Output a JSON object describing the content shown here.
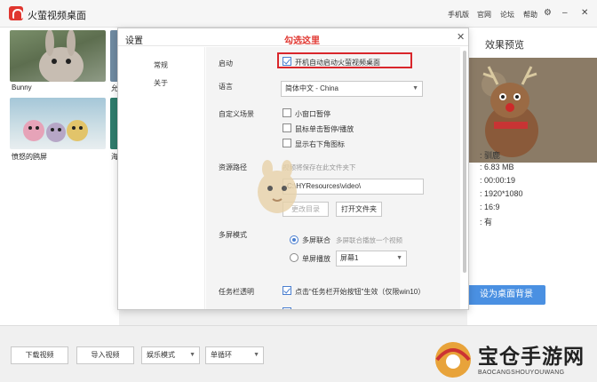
{
  "app": {
    "title": "火萤视频桌面"
  },
  "topnav": {
    "mobile": "手机版",
    "website": "官网",
    "forum": "论坛",
    "help": "帮助"
  },
  "wallpapers": [
    {
      "label": "Bunny"
    },
    {
      "label": "允"
    },
    {
      "label": "愤怒的鸥屏"
    },
    {
      "label": "海"
    }
  ],
  "preview": {
    "title": "效果预览",
    "name": "驯鹿",
    "size": "6.83 MB",
    "duration": "00:00:19",
    "resolution": "1920*1080",
    "ratio": "16:9",
    "sound": "有",
    "set_bg_label": "设为桌面背景"
  },
  "bottom": {
    "download_label": "下载视频",
    "import_label": "导入视频",
    "mode_value": "娱乐模式",
    "loop_value": "单循环"
  },
  "dialog": {
    "title": "设置",
    "hint": "勾选这里",
    "close_icon": "close-icon",
    "nav": {
      "general": "常规",
      "about": "关于"
    },
    "startup_label": "启动",
    "autostart_text": "开机自动启动火萤视频桌面",
    "language_label": "语言",
    "language_value": "简体中文 - China",
    "custom_label": "自定义场景",
    "option_window_pause": "小窗口暂停",
    "option_click_pause": "鼠标单击暂停/播放",
    "option_tray_icon": "显示右下角图标",
    "path_label": "资源路径",
    "path_hint": "视频将保存在此文件夹下",
    "path_value": "C:\\HYResources\\video\\",
    "change_dir": "更改目录",
    "open_folder": "打开文件夹",
    "multiscreen_label": "多屏模式",
    "multi_join": "多屏联合",
    "multi_join_hint": "多屏联合播放一个视频",
    "single_play": "单屏播放",
    "screen_value": "屏幕1",
    "taskbar_label": "任务栏透明",
    "taskbar_text": "点击“任务栏开始按钮”生效（仅限win10）"
  },
  "watermark": {
    "text": "宝仓手游网",
    "sub": "BAOCANGSHOUYOUWANG"
  },
  "colors": {
    "accent": "#4a90e2",
    "hint_red": "#e0362f",
    "box_red": "#d9262b"
  }
}
